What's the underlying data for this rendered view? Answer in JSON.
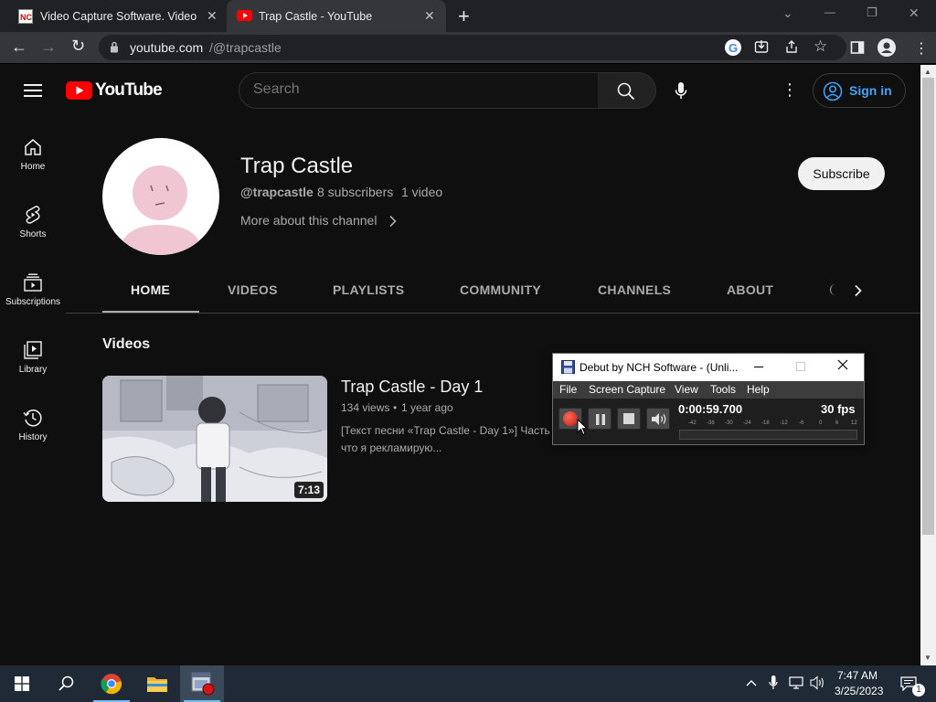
{
  "browser": {
    "tabs": [
      {
        "title": "Video Capture Software. Video, V",
        "favicon": "nch-icon"
      },
      {
        "title": "Trap Castle - YouTube",
        "favicon": "youtube-icon"
      }
    ],
    "new_tab_symbol": "+",
    "url_domain": "youtube.com",
    "url_path": "/@trapcastle",
    "window_controls": {
      "minimize": "—",
      "maximize": "❐",
      "close": "✕"
    }
  },
  "youtube": {
    "logo_text": "YouTube",
    "search_placeholder": "Search",
    "sign_in_label": "Sign in",
    "sidebar": [
      {
        "label": "Home",
        "icon": "home-icon"
      },
      {
        "label": "Shorts",
        "icon": "shorts-icon"
      },
      {
        "label": "Subscriptions",
        "icon": "subscriptions-icon"
      },
      {
        "label": "Library",
        "icon": "library-icon"
      },
      {
        "label": "History",
        "icon": "history-icon"
      }
    ],
    "channel": {
      "name": "Trap Castle",
      "handle": "@trapcastle",
      "subscribers": "8 subscribers",
      "video_count": "1 video",
      "more_about": "More about this channel",
      "subscribe_label": "Subscribe"
    },
    "nav_tabs": [
      "HOME",
      "VIDEOS",
      "PLAYLISTS",
      "COMMUNITY",
      "CHANNELS",
      "ABOUT"
    ],
    "active_tab": "HOME",
    "section_title": "Videos",
    "video": {
      "title": "Trap Castle - Day 1",
      "views": "134 views",
      "separator": "•",
      "age": "1 year ago",
      "desc_line1": "[Текст песни «Trap Castle - Day 1»] Часть",
      "desc_line2": "что я рекламирую...",
      "duration": "7:13"
    }
  },
  "debut": {
    "title": "Debut by NCH Software - (Unli...",
    "menu": [
      "File",
      "Screen Capture",
      "View",
      "Tools",
      "Help"
    ],
    "timer": "0:00:59.700",
    "fps": "30 fps",
    "meter_ticks": [
      "-42",
      "-36",
      "-30",
      "-24",
      "-18",
      "-12",
      "-6",
      "0",
      "6",
      "12"
    ]
  },
  "taskbar": {
    "time": "7:47 AM",
    "date": "3/25/2023",
    "notification_count": "1",
    "apps": [
      "windows-start",
      "search",
      "chrome",
      "file-explorer",
      "debut"
    ]
  }
}
